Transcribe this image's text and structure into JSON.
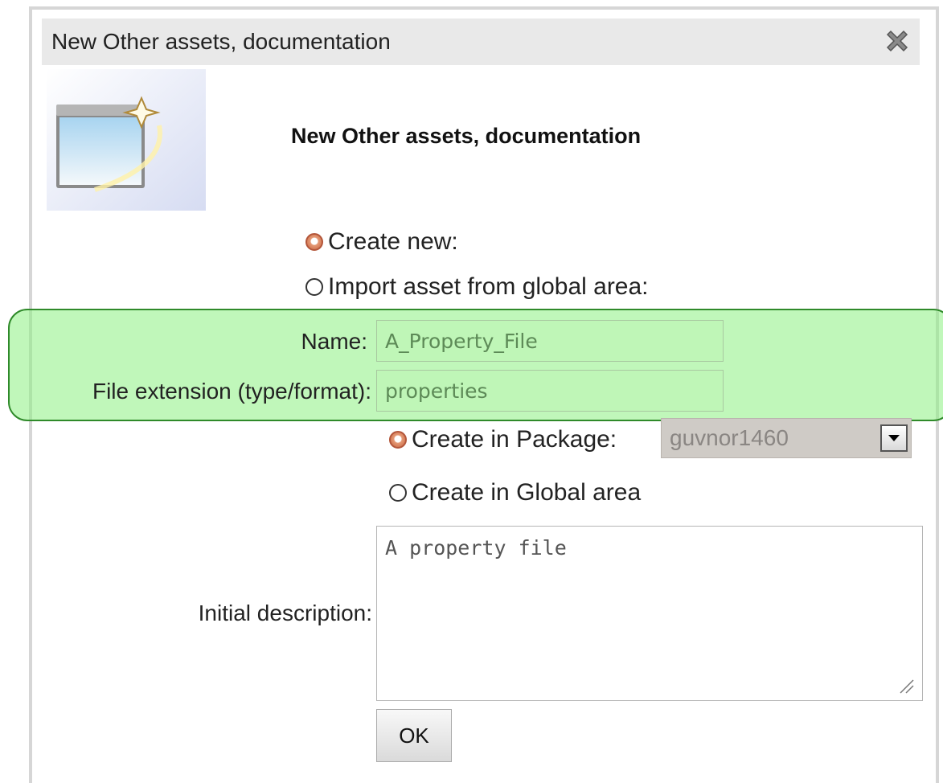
{
  "dialog": {
    "title": "New Other assets, documentation",
    "heading": "New Other assets, documentation"
  },
  "options": {
    "create_new": "Create new:",
    "import_global": "Import asset from global area:"
  },
  "form": {
    "name_label": "Name:",
    "name_value": "A_Property_File",
    "ext_label": "File extension (type/format):",
    "ext_value": "properties",
    "create_in_package": "Create in Package:",
    "package_selected": "guvnor1460",
    "create_in_global": "Create in Global area",
    "description_label": "Initial description:",
    "description_value": "A property file",
    "ok_label": "OK"
  },
  "icons": {
    "close": "close-icon",
    "asset": "new-asset-wizard-image",
    "dropdown": "chevron-down-icon"
  },
  "colors": {
    "highlight": "#8cf082",
    "radio_selected": "#c7643f",
    "select_bg": "#cfcbc6"
  }
}
